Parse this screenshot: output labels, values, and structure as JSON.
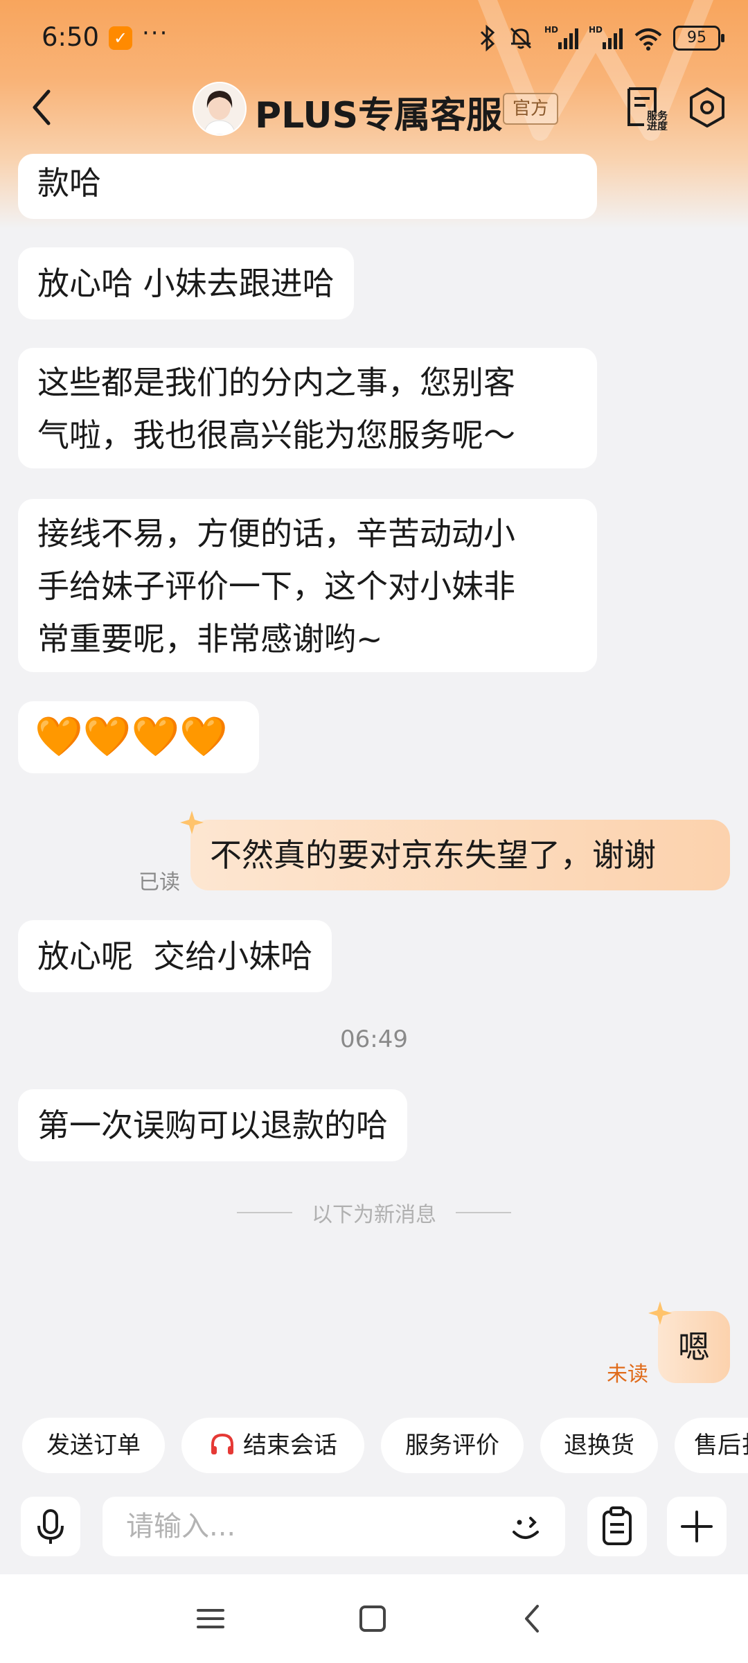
{
  "status_bar": {
    "time": "6:50",
    "app_badge": "⌀",
    "dots": "···",
    "signal_hd_1": "HD",
    "signal_hd_2": "HD",
    "battery": "95"
  },
  "nav": {
    "title": "PLUS专属客服",
    "official_tag": "官方",
    "service_progress_label_1": "服务",
    "service_progress_label_2": "进度"
  },
  "messages": {
    "m0": "款哈",
    "m1": "放心哈 小妹去跟进哈",
    "m2_line1": "这些都是我们的分内之事，您别客",
    "m2_line2": "气啦，我也很高兴能为您服务呢～",
    "m3_line1": "接线不易，方便的话，辛苦动动小",
    "m3_line2": "手给妹子评价一下，这个对小妹非",
    "m3_line3": "常重要呢，非常感谢哟~",
    "m4_hearts": "🧡🧡🧡🧡",
    "m5": "不然真的要对京东失望了，谢谢",
    "m5_status": "已读",
    "m6": "放心呢  交给小妹哈",
    "time_label": "06:49",
    "m7": "第一次误购可以退款的哈",
    "new_divider": "以下为新消息",
    "m8": "嗯",
    "m8_status": "未读"
  },
  "quick_actions": [
    {
      "label": "发送订单"
    },
    {
      "label": "结束会话"
    },
    {
      "label": "服务评价"
    },
    {
      "label": "退换货"
    },
    {
      "label": "售后扌"
    }
  ],
  "input": {
    "placeholder": "请输入..."
  },
  "colors": {
    "accent": "#f8a55d",
    "bubble_right": "#fcd2ad",
    "unread": "#e06b1a",
    "headset_red": "#e53935"
  },
  "icons": [
    "back-icon",
    "avatar",
    "service-progress-icon",
    "settings-icon",
    "star-icon",
    "headset-icon",
    "microphone-icon",
    "emoji-icon",
    "clipboard-icon",
    "plus-icon",
    "menu-icon",
    "home-icon",
    "nav-back-icon"
  ]
}
